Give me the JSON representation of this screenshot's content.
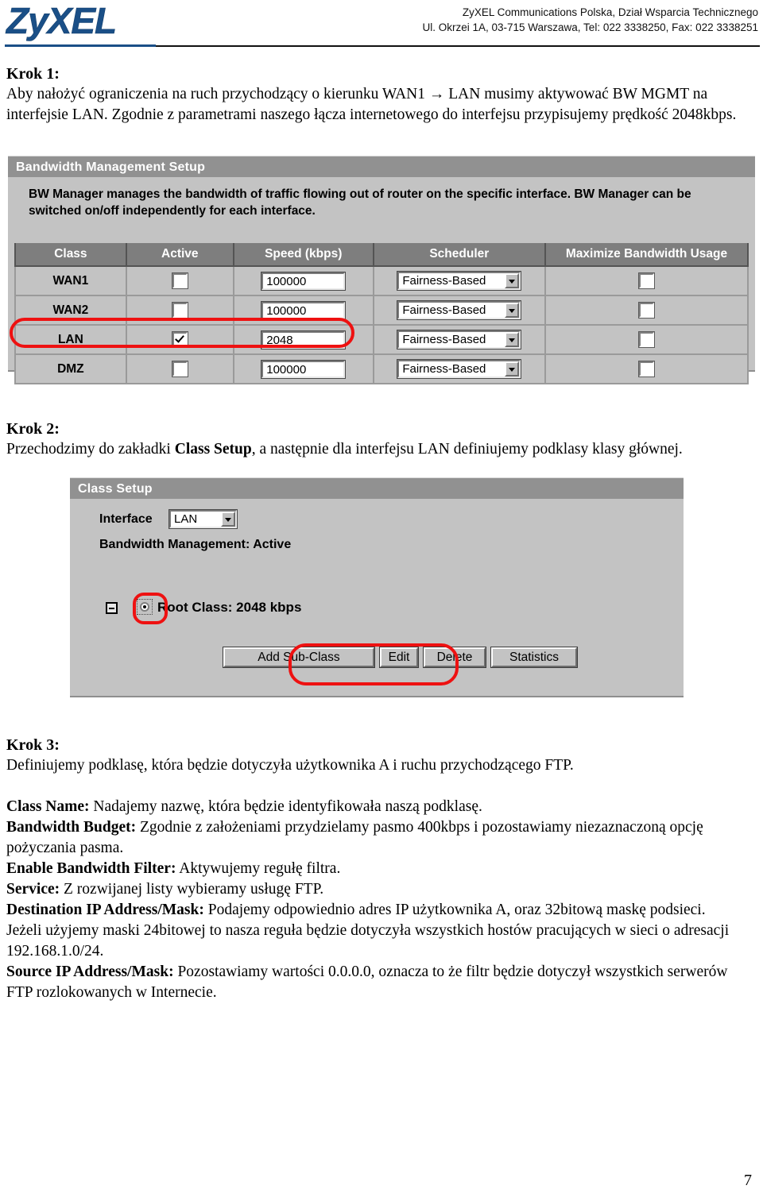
{
  "header": {
    "logo_text": "ZyXEL",
    "company_line1": "ZyXEL Communications Polska, Dział Wsparcia Technicznego",
    "company_line2": "Ul. Okrzei 1A, 03-715 Warszawa, Tel: 022 3338250, Fax: 022 3338251"
  },
  "colors": {
    "brand_blue": "#1a4f87",
    "panel_body": "#c3c3c3",
    "panel_titlebar": "#919191",
    "table_header": "#7e7e7e",
    "highlight_red": "#ee1111"
  },
  "step1": {
    "heading": "Krok 1:",
    "body": "Aby nałożyć ograniczenia na ruch przychodzący o kierunku WAN1 → LAN musimy aktywować BW MGMT na interfejsie LAN. Zgodnie z parametrami naszego łącza internetowego do interfejsu przypisujemy prędkość 2048kbps."
  },
  "bwm_panel": {
    "title": "Bandwidth Management Setup",
    "description": "BW Manager manages the bandwidth of traffic flowing out of router on the specific interface. BW Manager can be switched on/off independently for each interface.",
    "columns": [
      "Class",
      "Active",
      "Speed (kbps)",
      "Scheduler",
      "Maximize Bandwidth Usage"
    ],
    "rows": [
      {
        "class": "WAN1",
        "active": false,
        "speed": "100000",
        "scheduler": "Fairness-Based",
        "maximize": false,
        "highlighted": false
      },
      {
        "class": "WAN2",
        "active": false,
        "speed": "100000",
        "scheduler": "Fairness-Based",
        "maximize": false,
        "highlighted": false
      },
      {
        "class": "LAN",
        "active": true,
        "speed": "2048",
        "scheduler": "Fairness-Based",
        "maximize": false,
        "highlighted": true
      },
      {
        "class": "DMZ",
        "active": false,
        "speed": "100000",
        "scheduler": "Fairness-Based",
        "maximize": false,
        "highlighted": false
      }
    ]
  },
  "step2": {
    "heading": "Krok 2:",
    "body_pre": "Przechodzimy do zakładki ",
    "body_bold": "Class Setup",
    "body_post": ", a następnie dla interfejsu LAN definiujemy podklasy klasy głównej."
  },
  "class_panel": {
    "title": "Class Setup",
    "interface_label": "Interface",
    "interface_value": "LAN",
    "bwm_status": "Bandwidth Management: Active",
    "root_class_label": "Root Class: 2048 kbps",
    "buttons": [
      {
        "label": "Add Sub-Class",
        "highlighted": true
      },
      {
        "label": "Edit",
        "highlighted": false
      },
      {
        "label": "Delete",
        "highlighted": false
      },
      {
        "label": "Statistics",
        "highlighted": false
      }
    ]
  },
  "step3": {
    "heading": "Krok 3:",
    "intro": "Definiujemy podklasę, która będzie dotyczyła użytkownika A i ruchu przychodzącego FTP.",
    "items": [
      {
        "term": "Class Name:",
        "text": " Nadajemy nazwę, która będzie identyfikowała naszą podklasę."
      },
      {
        "term": "Bandwidth Budget:",
        "text": " Zgodnie z założeniami przydzielamy pasmo 400kbps i pozostawiamy niezaznaczoną opcję pożyczania pasma."
      },
      {
        "term": "Enable Bandwidth Filter:",
        "text": " Aktywujemy regułę filtra."
      },
      {
        "term": "Service:",
        "text": " Z rozwijanej listy wybieramy usługę FTP."
      },
      {
        "term": "Destination IP Address/Mask:",
        "text": " Podajemy odpowiednio adres IP użytkownika A, oraz 32bitową maskę podsieci."
      },
      {
        "term": "",
        "text": "Jeżeli użyjemy maski 24bitowej to nasza reguła będzie dotyczyła wszystkich hostów pracujących w sieci o adresacji 192.168.1.0/24."
      },
      {
        "term": "Source IP Address/Mask:",
        "text": " Pozostawiamy wartości 0.0.0.0, oznacza to że filtr będzie dotyczył wszystkich serwerów FTP rozlokowanych w Internecie."
      }
    ]
  },
  "footer": {
    "page_number": "7"
  }
}
